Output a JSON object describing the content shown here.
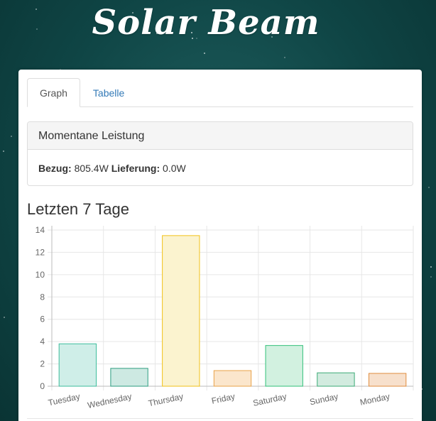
{
  "app": {
    "title": "Solar Beam"
  },
  "tabs": [
    {
      "label": "Graph",
      "active": true
    },
    {
      "label": "Tabelle",
      "active": false
    }
  ],
  "live": {
    "heading": "Momentane Leistung",
    "bezug_label": "Bezug:",
    "bezug_value": "805.4W",
    "lieferung_label": "Lieferung:",
    "lieferung_value": "0.0W"
  },
  "section": {
    "title": "Letzten 7 Tage"
  },
  "chart_data": {
    "type": "bar",
    "categories": [
      "Tuesday",
      "Wednesday",
      "Thursday",
      "Friday",
      "Saturday",
      "Sunday",
      "Monday"
    ],
    "values": [
      3.8,
      1.6,
      13.5,
      1.4,
      3.65,
      1.2,
      1.15
    ],
    "ylim": [
      0,
      14
    ],
    "yticks": [
      0,
      2,
      4,
      6,
      8,
      10,
      12,
      14
    ],
    "grid": true,
    "colors": [
      {
        "fill": "#cfeee8",
        "stroke": "#3ebd9c"
      },
      {
        "fill": "#cde9e2",
        "stroke": "#2d9d80"
      },
      {
        "fill": "#fbf3cf",
        "stroke": "#f1c21a"
      },
      {
        "fill": "#fbe6cc",
        "stroke": "#e8a349"
      },
      {
        "fill": "#d2f1e0",
        "stroke": "#33c07a"
      },
      {
        "fill": "#d2ebdf",
        "stroke": "#3cab77"
      },
      {
        "fill": "#f7e0cc",
        "stroke": "#e08d3f"
      }
    ]
  }
}
